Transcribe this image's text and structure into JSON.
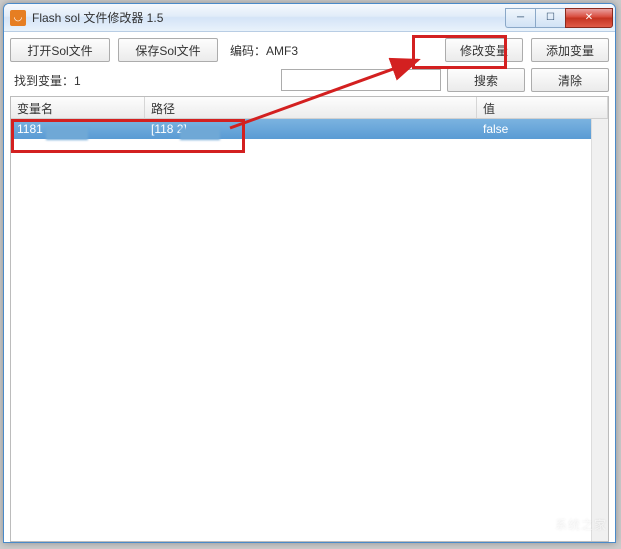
{
  "window": {
    "title": "Flash sol 文件修改器 1.5"
  },
  "toolbar": {
    "open_label": "打开Sol文件",
    "save_label": "保存Sol文件",
    "encoding_label": "编码：AMF3",
    "modify_label": "修改变量",
    "add_label": "添加变量"
  },
  "search": {
    "found_label": "找到变量：1",
    "search_label": "搜索",
    "clear_label": "清除",
    "placeholder": ""
  },
  "table": {
    "headers": {
      "name": "变量名",
      "path": "路径",
      "value": "值"
    },
    "rows": [
      {
        "name": "1181",
        "path": "[118        2]",
        "value": "false"
      }
    ]
  }
}
